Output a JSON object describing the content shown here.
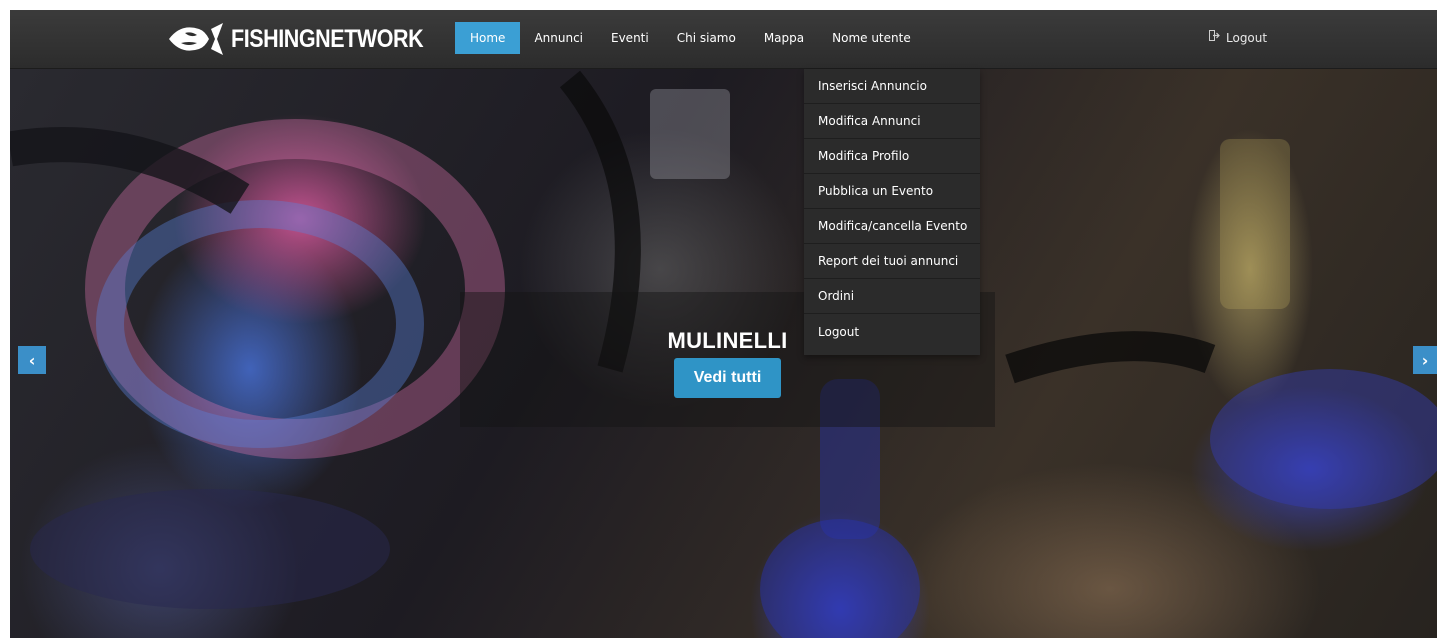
{
  "colors": {
    "navbar_bg": "#333333",
    "accent": "#3b9fd4",
    "button": "#2f94c6",
    "dropdown_bg": "#2b2b2b"
  },
  "navbar": {
    "brand": {
      "text": "FISHINGNETWORK",
      "icon": "fish-logo-icon"
    },
    "items": [
      {
        "label": "Home",
        "active": true
      },
      {
        "label": "Annunci"
      },
      {
        "label": "Eventi"
      },
      {
        "label": "Chi siamo"
      },
      {
        "label": "Mappa"
      },
      {
        "label": "Nome utente"
      }
    ],
    "logout": {
      "label": "Logout",
      "icon": "logout-icon"
    }
  },
  "dropdown": {
    "items": [
      {
        "label": "Inserisci Annuncio"
      },
      {
        "label": "Modifica Annunci"
      },
      {
        "label": "Modifica Profilo"
      },
      {
        "label": "Pubblica un Evento"
      },
      {
        "label": "Modifica/cancella Evento"
      },
      {
        "label": "Report dei tuoi annunci"
      },
      {
        "label": "Ordini"
      },
      {
        "label": "Logout"
      }
    ]
  },
  "carousel": {
    "slide": {
      "title": "MULINELLI",
      "button_label": "Vedi tutti",
      "image": "fishing-reel-photo"
    },
    "prev_icon": "chevron-left-icon",
    "next_icon": "chevron-right-icon",
    "prev_glyph": "‹",
    "next_glyph": "›"
  }
}
